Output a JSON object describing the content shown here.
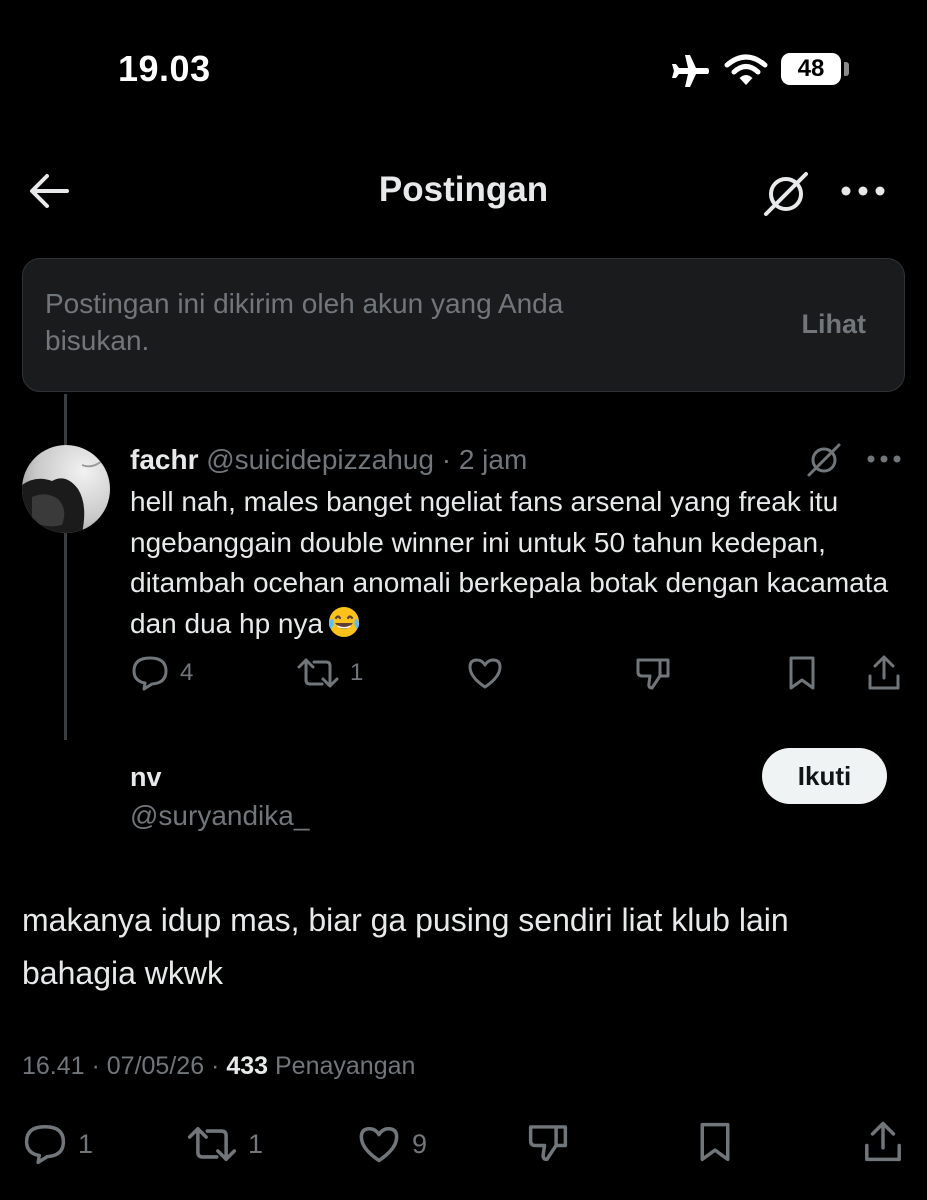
{
  "status_bar": {
    "time": "19.03",
    "battery": "48"
  },
  "header": {
    "title": "Postingan"
  },
  "muted_notice": {
    "text": "Postingan ini dikirim oleh akun yang Anda bisukan.",
    "button": "Lihat"
  },
  "parent_post": {
    "display_name": "fachr",
    "handle": "@suicidepizzahug",
    "separator": "·",
    "time": "2 jam",
    "text": "hell nah, males banget ngeliat fans arsenal yang freak itu ngebanggain double winner ini untuk 50 tahun kedepan, ditambah ocehan anomali berkepala botak dengan kacamata dan dua hp nya",
    "emoji": "face-with-tears-of-joy",
    "replies": "4",
    "reposts": "1"
  },
  "reply_post": {
    "display_name": "nv",
    "handle": "@suryandika_",
    "follow_label": "Ikuti",
    "text": "makanya idup mas, biar ga pusing sendiri liat klub lain bahagia wkwk",
    "timestamp": "16.41 · 07/05/26 ·",
    "views_count": "433",
    "views_label": "Penayangan",
    "replies": "1",
    "reposts": "1",
    "likes": "9"
  }
}
